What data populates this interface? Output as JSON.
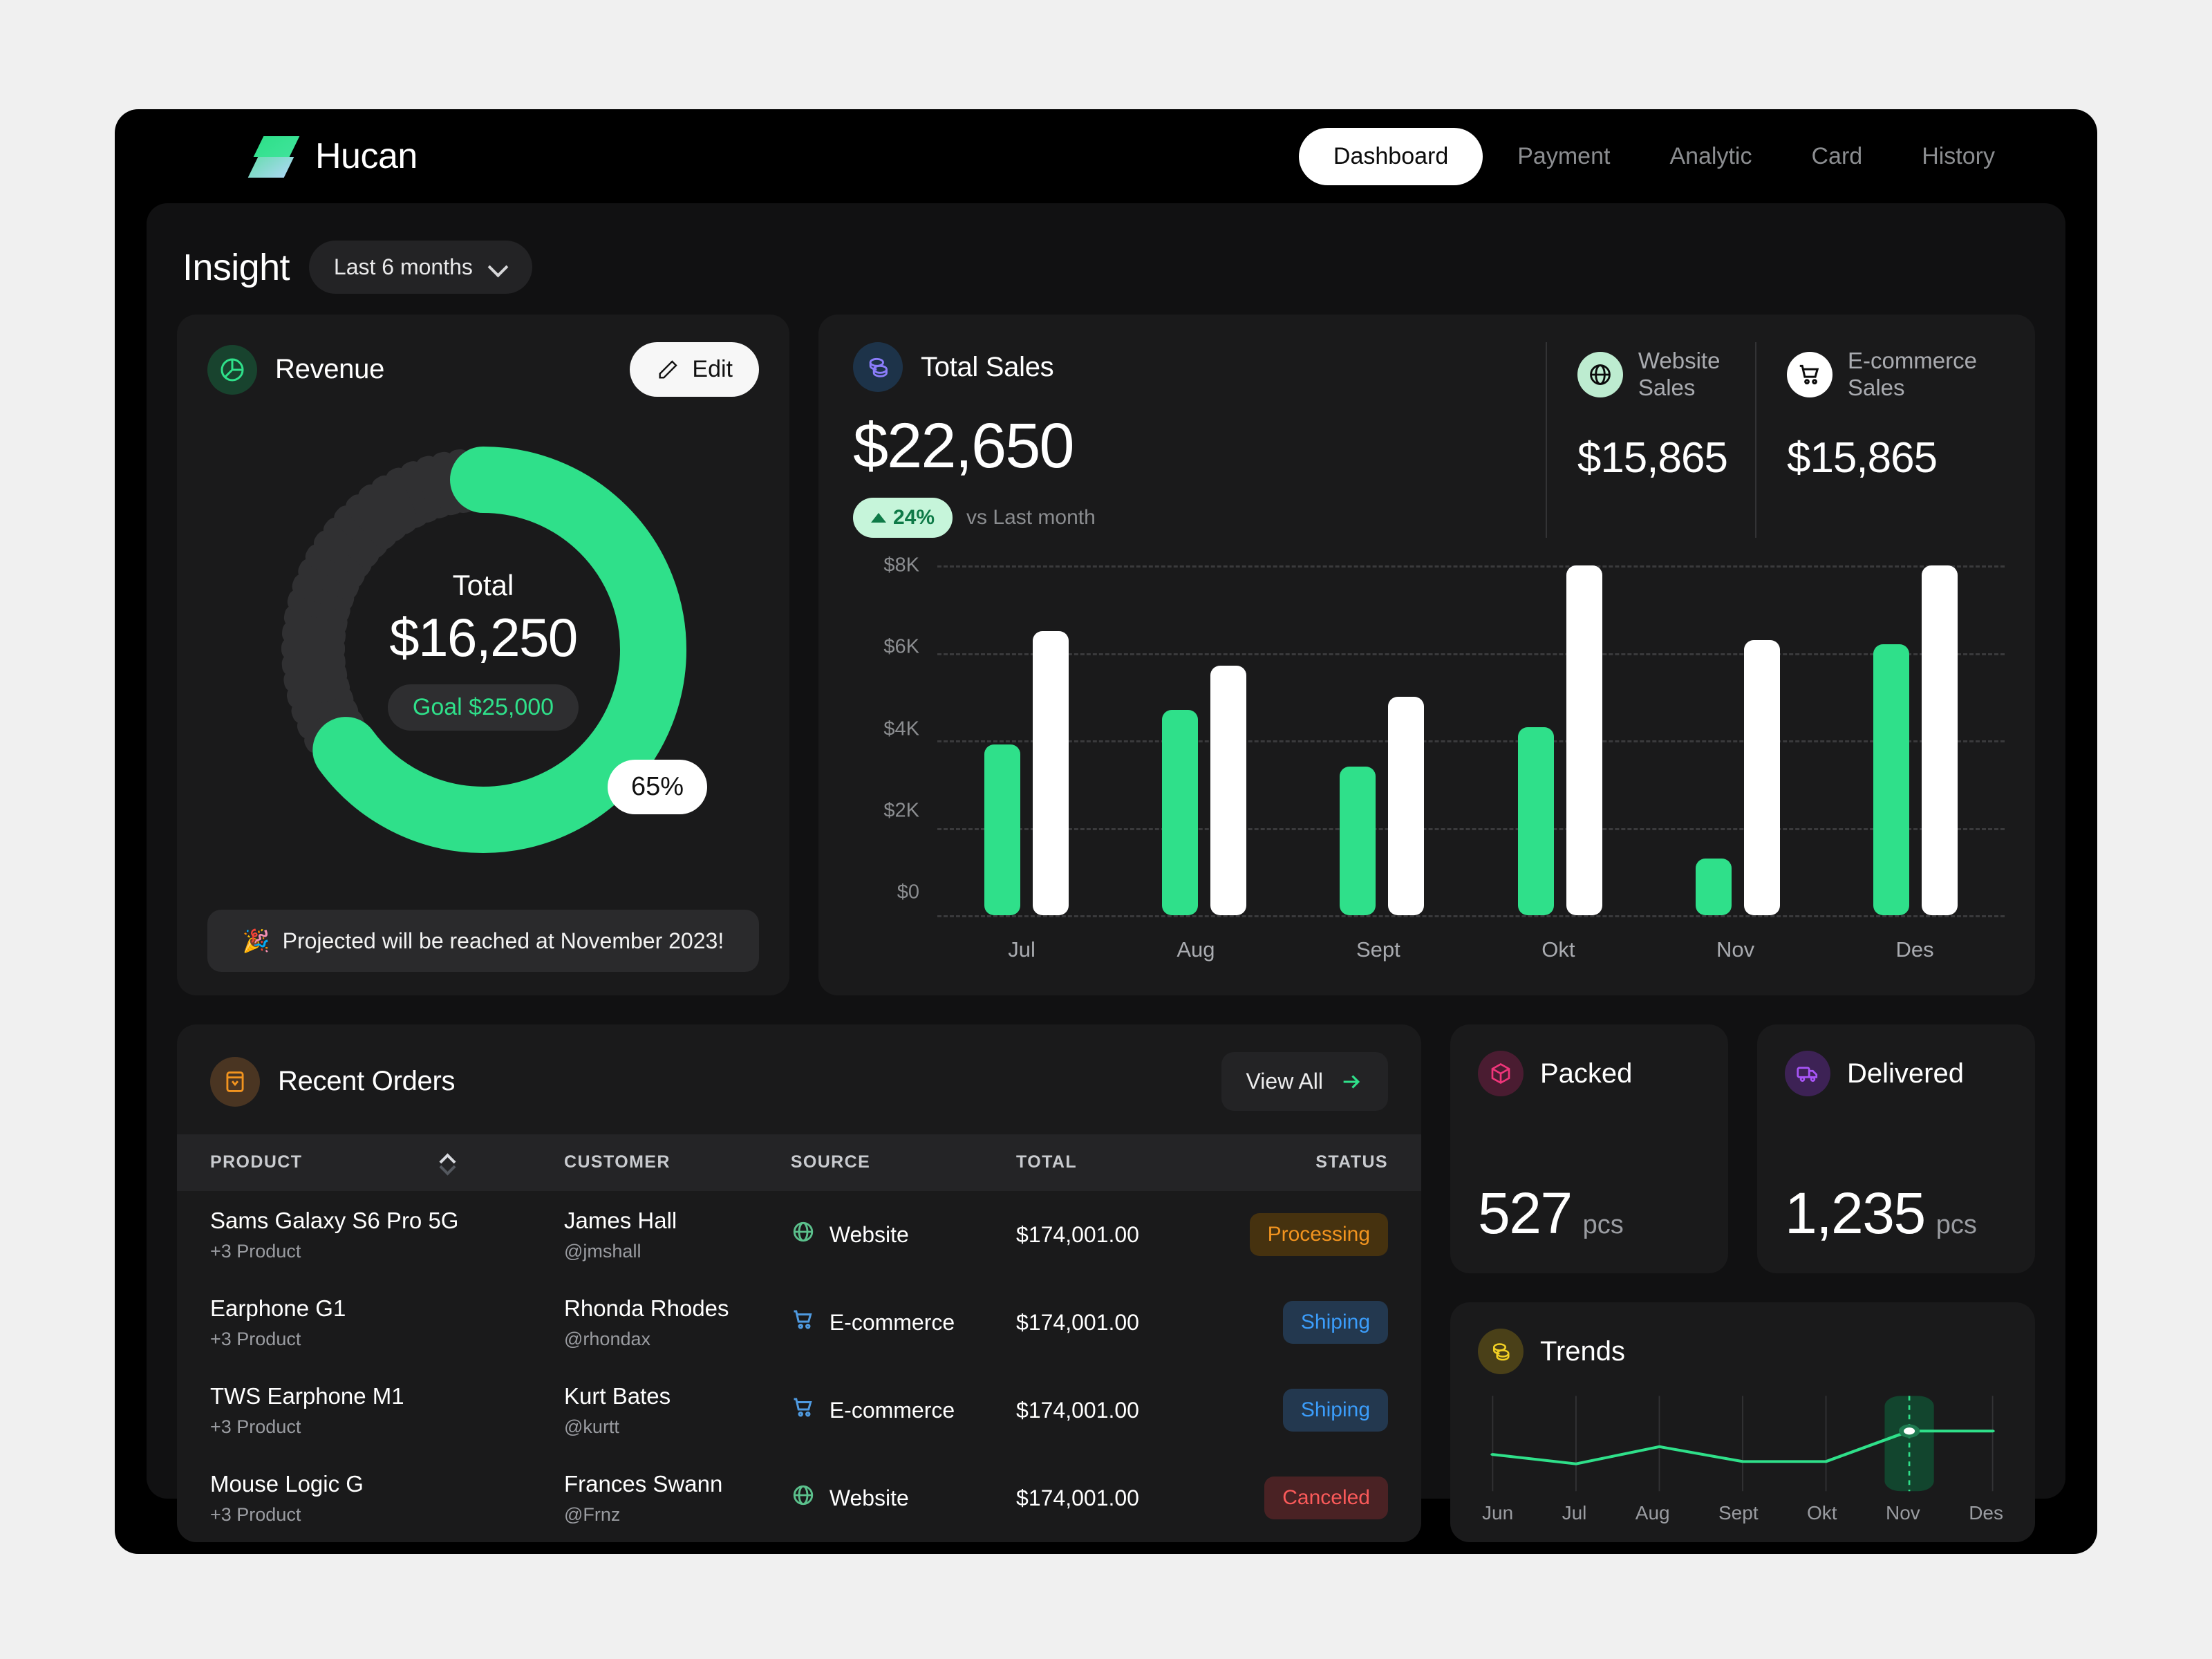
{
  "brand": {
    "name": "Hucan",
    "logo_icon": "hucan-logo"
  },
  "nav": [
    {
      "label": "Dashboard",
      "active": true
    },
    {
      "label": "Payment",
      "active": false
    },
    {
      "label": "Analytic",
      "active": false
    },
    {
      "label": "Card",
      "active": false
    },
    {
      "label": "History",
      "active": false
    }
  ],
  "page": {
    "title": "Insight",
    "range": "Last 6 months"
  },
  "revenue": {
    "title": "Revenue",
    "icon": "pie-chart-icon",
    "edit_label": "Edit",
    "edit_icon": "pencil-icon",
    "center_label": "Total",
    "center_value": "$16,250",
    "goal": "Goal $25,000",
    "percent": "65%",
    "projected": "Projected will be reached at November 2023!",
    "projected_icon": "party-popper-icon",
    "accent": "#2fe08a",
    "track": "#303032"
  },
  "sales": {
    "title": "Total Sales",
    "icon": "coins-icon",
    "amount": "$22,650",
    "delta": "24%",
    "delta_note": "vs Last month",
    "kpis": [
      {
        "label_line1": "Website",
        "label_line2": "Sales",
        "value": "$15,865",
        "icon": "globe-icon",
        "icon_bg": "#bdecd0"
      },
      {
        "label_line1": "E-commerce",
        "label_line2": "Sales",
        "value": "$15,865",
        "icon": "shopping-cart-icon",
        "icon_bg": "#ffffff"
      }
    ]
  },
  "chart_data": {
    "type": "bar",
    "title": "Total Sales",
    "categories": [
      "Jul",
      "Aug",
      "Sept",
      "Okt",
      "Nov",
      "Des"
    ],
    "series": [
      {
        "name": "Website Sales",
        "color": "#2fe08a",
        "values": [
          3900,
          4700,
          3400,
          4300,
          1300,
          6200
        ]
      },
      {
        "name": "E-commerce Sales",
        "color": "#ffffff",
        "values": [
          6500,
          5700,
          5000,
          8000,
          6300,
          8000
        ]
      }
    ],
    "ylabel": "",
    "xlabel": "",
    "ylim": [
      0,
      8000
    ],
    "yticks": [
      "$0",
      "$2K",
      "$4K",
      "$6K",
      "$8K"
    ],
    "ytick_values": [
      0,
      2000,
      4000,
      6000,
      8000
    ],
    "grid": true,
    "legend": "none"
  },
  "orders": {
    "title": "Recent Orders",
    "icon": "inbox-icon",
    "view_all": "View All",
    "view_all_icon": "arrow-right-icon",
    "columns": [
      "PRODUCT",
      "CUSTOMER",
      "SOURCE",
      "TOTAL",
      "STATUS"
    ],
    "rows": [
      {
        "product": "Sams Galaxy S6 Pro 5G",
        "product_sub": "+3 Product",
        "customer": "James Hall",
        "handle": "@jmshall",
        "source": "Website",
        "source_icon": "globe-icon",
        "total": "$174,001.00",
        "status": "Processing",
        "status_kind": "processing"
      },
      {
        "product": "Earphone G1",
        "product_sub": "+3 Product",
        "customer": "Rhonda Rhodes",
        "handle": "@rhondax",
        "source": "E-commerce",
        "source_icon": "shopping-cart-icon",
        "total": "$174,001.00",
        "status": "Shiping",
        "status_kind": "shiping"
      },
      {
        "product": "TWS Earphone M1",
        "product_sub": "+3 Product",
        "customer": "Kurt Bates",
        "handle": "@kurtt",
        "source": "E-commerce",
        "source_icon": "shopping-cart-icon",
        "total": "$174,001.00",
        "status": "Shiping",
        "status_kind": "shiping"
      },
      {
        "product": "Mouse Logic G",
        "product_sub": "+3 Product",
        "customer": "Frances Swann",
        "handle": "@Frnz",
        "source": "Website",
        "source_icon": "globe-icon",
        "total": "$174,001.00",
        "status": "Canceled",
        "status_kind": "canceled"
      }
    ]
  },
  "packed": {
    "title": "Packed",
    "value": "527",
    "unit": "pcs",
    "icon": "package-icon",
    "icon_color": "#f0357a"
  },
  "delivered": {
    "title": "Delivered",
    "value": "1,235",
    "unit": "pcs",
    "icon": "truck-icon",
    "icon_color": "#a855f7"
  },
  "trends": {
    "title": "Trends",
    "icon": "coins-icon",
    "months": [
      "Jun",
      "Jul",
      "Aug",
      "Sept",
      "Okt",
      "Nov",
      "Des"
    ],
    "values": [
      42,
      30,
      52,
      33,
      33,
      72,
      72
    ],
    "highlight_month": "Nov",
    "line_color": "#2fe08a"
  }
}
